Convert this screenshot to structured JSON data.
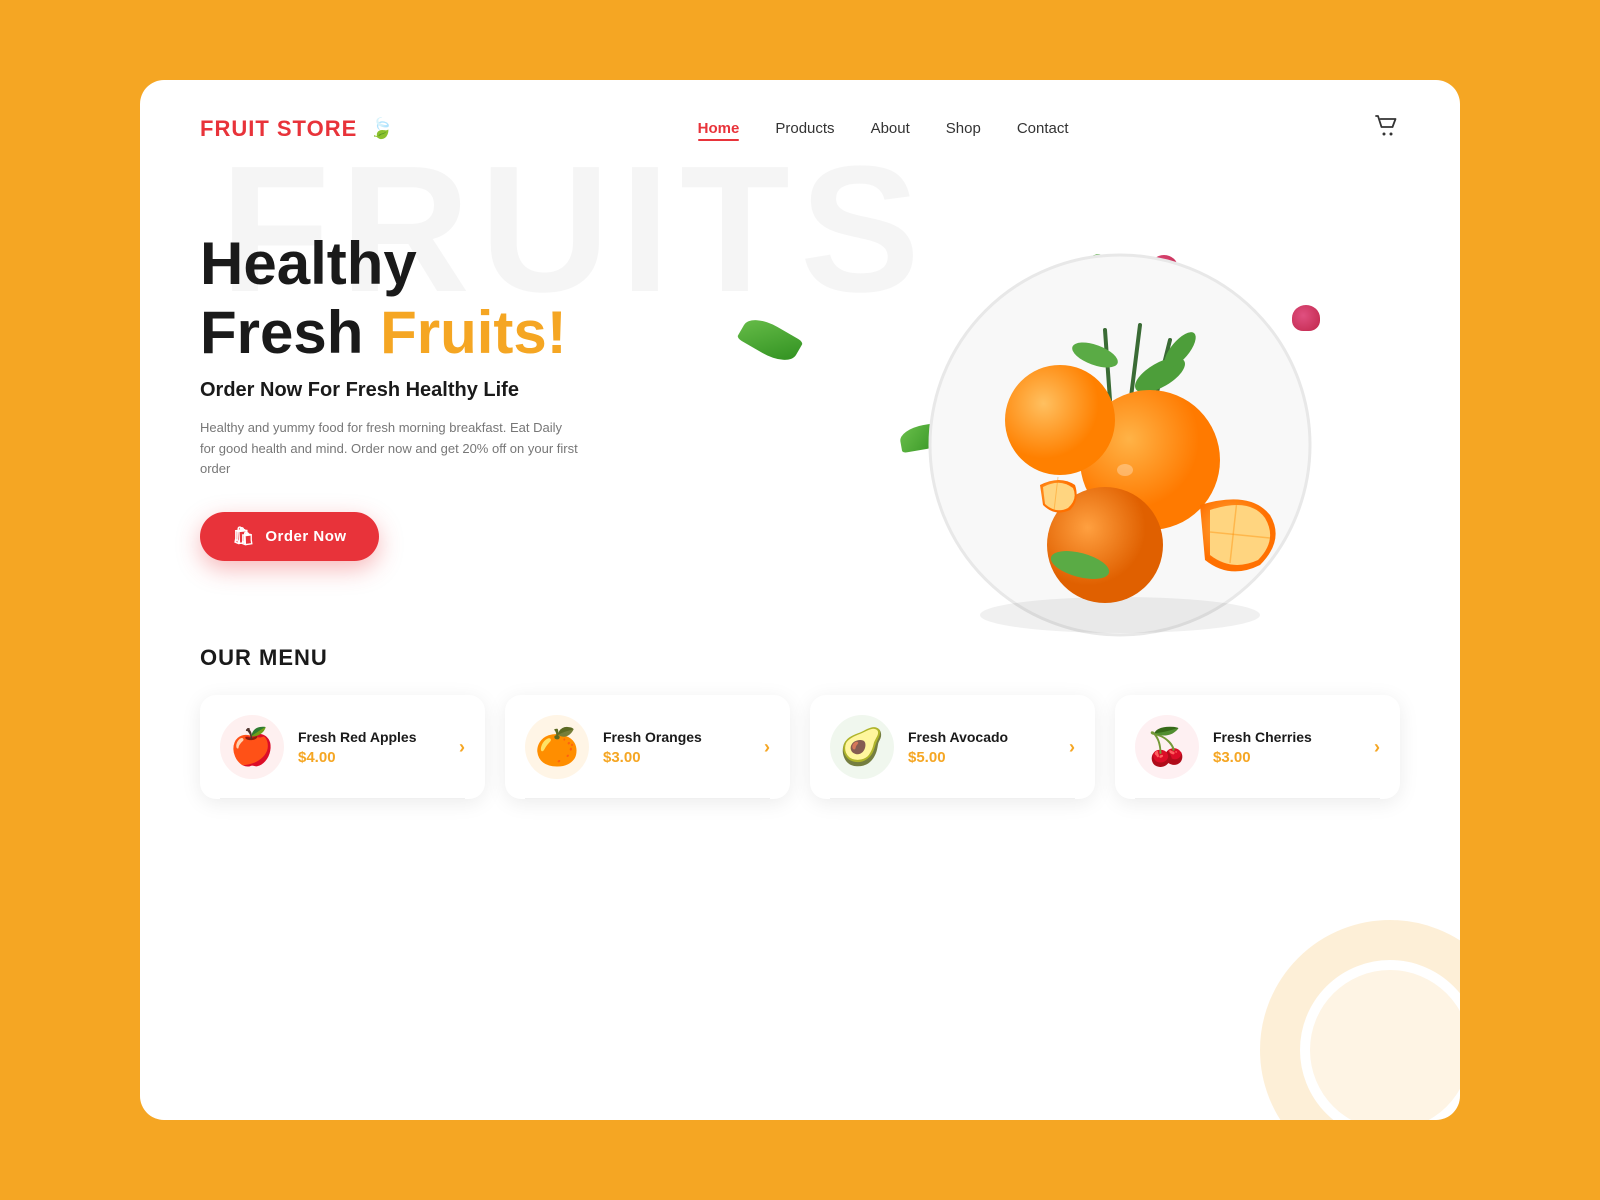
{
  "brand": {
    "name_fruit": "FRUIT",
    "name_store": " STORE",
    "leaf_emoji": "🍃"
  },
  "nav": {
    "links": [
      {
        "label": "Home",
        "active": true
      },
      {
        "label": "Products",
        "active": false
      },
      {
        "label": "About",
        "active": false
      },
      {
        "label": "Shop",
        "active": false
      },
      {
        "label": "Contact",
        "active": false
      }
    ]
  },
  "hero": {
    "title_line1": "Healthy",
    "title_line2_black": "Fresh ",
    "title_line2_orange": "Fruits!",
    "subtitle": "Order Now For Fresh Healthy Life",
    "description": "Healthy and yummy food for fresh morning breakfast. Eat Daily for good health and mind. Order now and get 20% off on your first order",
    "cta_label": "Order Now",
    "watermark": "FRUITS"
  },
  "menu": {
    "section_title": "OUR MENU",
    "items": [
      {
        "name": "Fresh Red Apples",
        "price": "$4.00",
        "emoji": "🍎",
        "bg": "#fef0f0"
      },
      {
        "name": "Fresh Oranges",
        "price": "$3.00",
        "emoji": "🍊",
        "bg": "#fff5e6"
      },
      {
        "name": "Fresh Avocado",
        "price": "$5.00",
        "emoji": "🥑",
        "bg": "#f0f7ee"
      },
      {
        "name": "Fresh Cherries",
        "price": "$3.00",
        "emoji": "🍒",
        "bg": "#fef0f2"
      }
    ]
  },
  "colors": {
    "primary_red": "#E8333A",
    "orange_accent": "#F5A623",
    "bg_orange": "#F5A623",
    "white": "#ffffff",
    "text_dark": "#1a1a1a"
  }
}
